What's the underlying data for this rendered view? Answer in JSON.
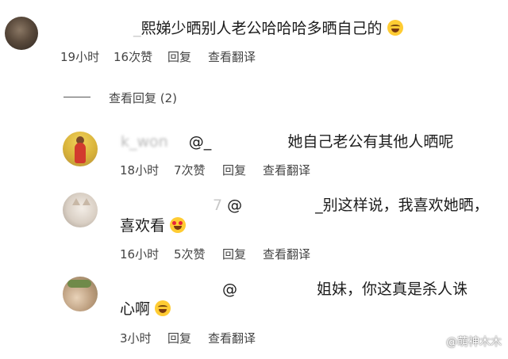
{
  "comments": [
    {
      "name": "",
      "text": "熙娣少晒别人老公哈哈哈多晒自己的",
      "emoji": "grinning-sweat-emoji",
      "time": "19小时",
      "likes": "16次赞",
      "reply": "回复",
      "translate": "查看翻译"
    }
  ],
  "replies_toggle": "查看回复 (2)",
  "replies": [
    {
      "name": "k_won",
      "mention": "@_",
      "text": "她自己老公有其他人晒呢",
      "time": "18小时",
      "likes": "7次赞",
      "reply": "回复",
      "translate": "查看翻译"
    },
    {
      "name": "7",
      "mention": "@",
      "text_line1": "_别这样说，我喜欢她晒，",
      "text_line2": "喜欢看",
      "emoji": "heart-eyes-emoji",
      "time": "16小时",
      "likes": "5次赞",
      "reply": "回复",
      "translate": "查看翻译"
    },
    {
      "name": "",
      "mention": "@",
      "text_line1": "姐妹，你这真是杀人诛",
      "text_line2": "心啊",
      "emoji": "grinning-sweat-emoji",
      "time": "3小时",
      "reply": "回复",
      "translate": "查看翻译"
    }
  ],
  "watermark": "@萌神木木"
}
